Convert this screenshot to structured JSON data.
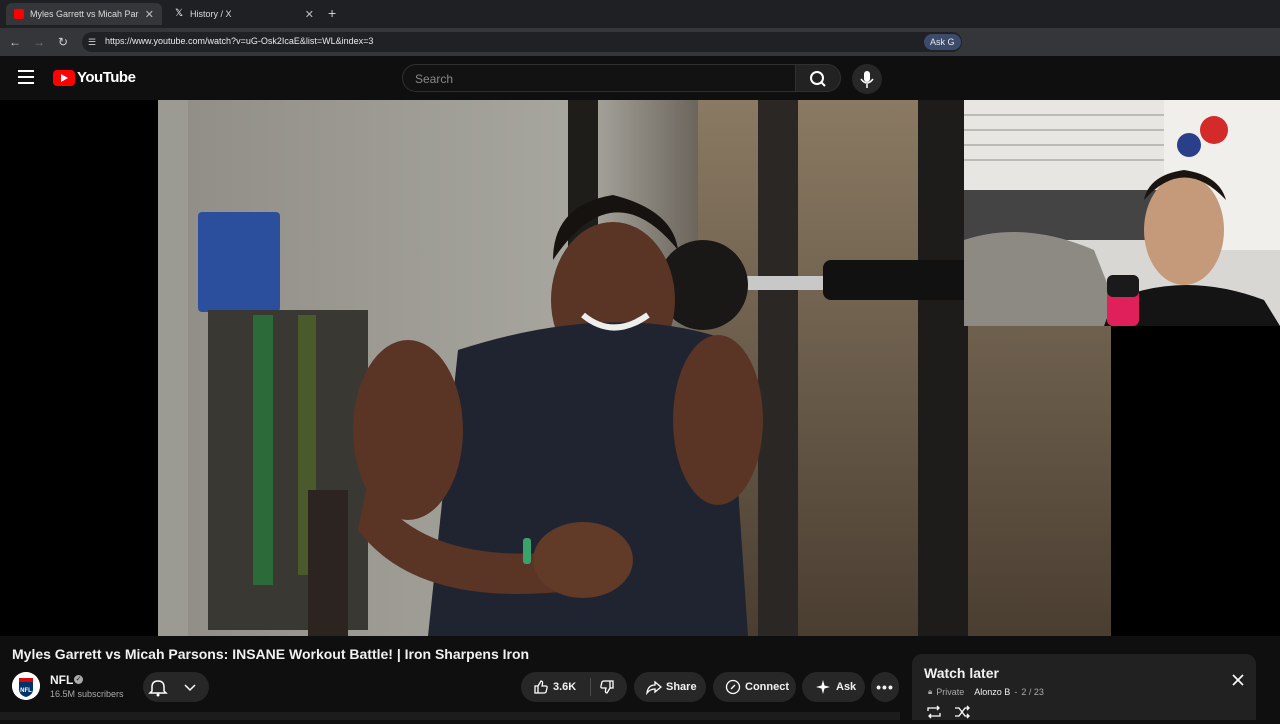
{
  "browser": {
    "tabs": [
      {
        "title": "Myles Garrett vs Micah Parsons",
        "active": true,
        "favicon": "youtube-icon"
      },
      {
        "title": "History / X",
        "active": false,
        "favicon": "x-icon"
      }
    ],
    "url": "https://www.youtube.com/watch?v=uG-Osk2IcaE&list=WL&index=3",
    "ask_chip": "Ask G"
  },
  "youtube": {
    "logo_text": "YouTube",
    "search_placeholder": "Search"
  },
  "video": {
    "title": "Myles Garrett vs Micah Parsons: INSANE Workout Battle! | Iron Sharpens Iron",
    "channel": {
      "name": "NFL",
      "avatar_text": "NFL",
      "subscribers": "16.5M subscribers"
    },
    "actions": {
      "likes": "3.6K",
      "share": "Share",
      "connect": "Connect",
      "ask": "Ask"
    }
  },
  "watch_later": {
    "title": "Watch later",
    "privacy": "Private",
    "owner": "Alonzo B",
    "position": "2 / 23"
  },
  "colors": {
    "brand_red": "#ff0000",
    "background": "#0f0f0f",
    "pill_bg": "#272727",
    "panel_bg": "#212121"
  }
}
